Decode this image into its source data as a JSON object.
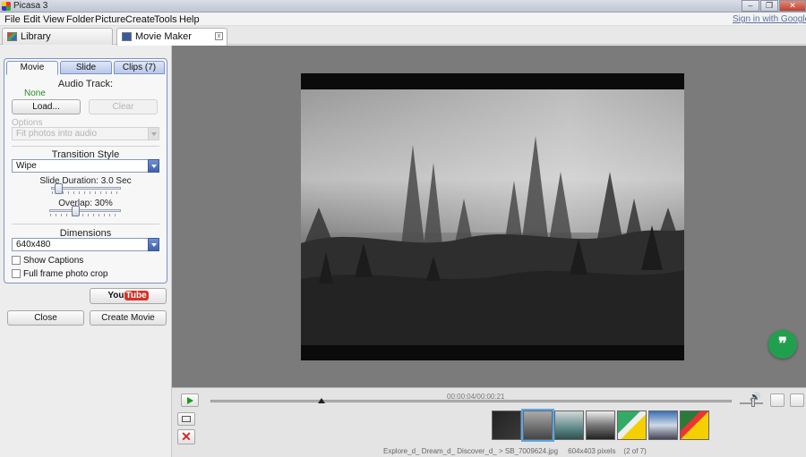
{
  "window": {
    "title": "Picasa 3",
    "minimize": "–",
    "restore": "❐",
    "close": "✕"
  },
  "menu": {
    "items": [
      "File",
      "Edit",
      "View",
      "Folder",
      "Picture",
      "Create",
      "Tools",
      "Help"
    ],
    "sign_in": "Sign in with Google Account"
  },
  "tabs": {
    "library": "Library",
    "movie_maker": "Movie Maker",
    "close_glyph": "x"
  },
  "panel": {
    "tabs": [
      "Movie",
      "Slide",
      "Clips (7)"
    ],
    "audio_track_title": "Audio Track:",
    "audio_track_value": "None",
    "load_button": "Load...",
    "clear_button": "Clear",
    "options_label": "Options",
    "options_select": "Fit photos into audio",
    "transition_title": "Transition Style",
    "transition_value": "Wipe",
    "slide_duration_label": "Slide Duration: 3.0 Sec",
    "overlap_label": "Overlap: 30%",
    "dimensions_title": "Dimensions",
    "dimensions_value": "640x480",
    "show_captions": "Show Captions",
    "full_frame": "Full frame photo crop"
  },
  "actions": {
    "youtube_you": "You",
    "youtube_tube": "Tube",
    "close_button": "Close",
    "create_button": "Create Movie"
  },
  "preview": {
    "fab_glyph": "❞"
  },
  "player": {
    "timecode": "00:00:04/00:00:21",
    "volume_icon": "🔊"
  },
  "status": {
    "filename": "Explore_d_ Dream_d_ Discover_d_ > SB_7009624.jpg",
    "dimensions": "604x403 pixels",
    "position": "(2 of 7)"
  },
  "colors": {
    "accent_blue": "#4a6fbe",
    "panel_border": "#7d93c4",
    "green": "#2a8a2a",
    "fab_green": "#20a04e"
  }
}
